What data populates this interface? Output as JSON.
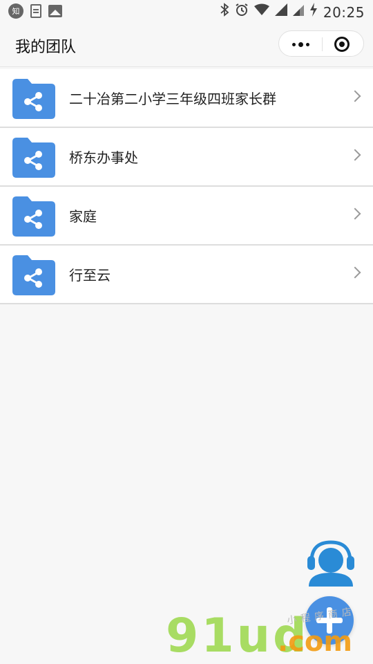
{
  "status_bar": {
    "app_badge": "知",
    "time": "20:25",
    "icons": [
      "zhihu-app-icon",
      "document-icon",
      "image-icon",
      "bluetooth-icon",
      "alarm-icon",
      "wifi-icon",
      "signal-icon",
      "battery-charging-icon"
    ]
  },
  "header": {
    "title": "我的团队",
    "capsule": {
      "more_icon": "more-dots-icon",
      "close_icon": "target-close-icon"
    }
  },
  "teams": [
    {
      "name": "二十冶第二小学三年级四班家长群"
    },
    {
      "name": "桥东办事处"
    },
    {
      "name": "家庭"
    },
    {
      "name": "行至云"
    }
  ],
  "fabs": {
    "support_icon": "customer-service-headset-icon",
    "add_icon": "plus-icon"
  },
  "watermark": {
    "main": "91ud",
    "suffix": ".com",
    "sub": "小程序商店"
  },
  "colors": {
    "accent": "#4a90e2",
    "folder": "#4a90e2",
    "watermark_green": "#9bd84a",
    "watermark_orange": "#f39c12"
  }
}
